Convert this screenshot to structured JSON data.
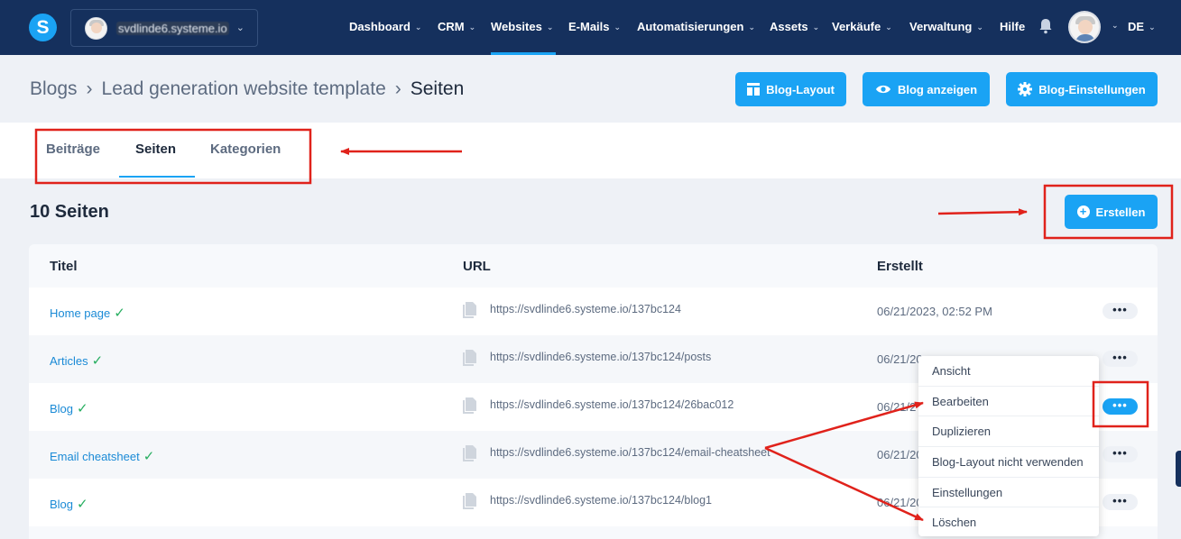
{
  "nav": {
    "account_name": "svdlinde6.systeme.io",
    "logo_letter": "S",
    "items": [
      {
        "label": "Dashboard",
        "dropdown": true
      },
      {
        "label": "CRM",
        "dropdown": true
      },
      {
        "label": "Websites",
        "dropdown": true,
        "active": true
      },
      {
        "label": "E-Mails",
        "dropdown": true
      },
      {
        "label": "Automatisierungen",
        "dropdown": true
      },
      {
        "label": "Assets",
        "dropdown": true
      },
      {
        "label": "Verkäufe",
        "dropdown": true
      },
      {
        "label": "Verwaltung",
        "dropdown": true
      },
      {
        "label": "Hilfe",
        "dropdown": false
      }
    ],
    "language": "DE"
  },
  "breadcrumb": {
    "items": [
      "Blogs",
      "Lead generation website template",
      "Seiten"
    ]
  },
  "header_buttons": {
    "layout": "Blog-Layout",
    "view": "Blog anzeigen",
    "settings": "Blog-Einstellungen"
  },
  "tabs": [
    "Beiträge",
    "Seiten",
    "Kategorien"
  ],
  "active_tab": "Seiten",
  "count_title": "10 Seiten",
  "create_label": "Erstellen",
  "table": {
    "headers": {
      "title": "Titel",
      "url": "URL",
      "created": "Erstellt"
    },
    "rows": [
      {
        "title": "Home page",
        "url": "https://svdlinde6.systeme.io/137bc124",
        "created": "06/21/2023, 02:52 PM"
      },
      {
        "title": "Articles",
        "url": "https://svdlinde6.systeme.io/137bc124/posts",
        "created": "06/21/20"
      },
      {
        "title": "Blog",
        "url": "https://svdlinde6.systeme.io/137bc124/26bac012",
        "created": "06/21/2"
      },
      {
        "title": "Email cheatsheet",
        "url": "https://svdlinde6.systeme.io/137bc124/email-cheatsheet",
        "created": "06/21/20"
      },
      {
        "title": "Blog",
        "url": "https://svdlinde6.systeme.io/137bc124/blog1",
        "created": "06/21/20"
      }
    ],
    "more_label": "•••"
  },
  "menu": {
    "items": [
      "Ansicht",
      "Bearbeiten",
      "Duplizieren",
      "Blog-Layout nicht verwenden",
      "Einstellungen",
      "Löschen"
    ]
  },
  "colors": {
    "nav_bg": "#15305d",
    "accent": "#1aa3f4",
    "annotation": "#e0221b",
    "check": "#27ae60"
  }
}
